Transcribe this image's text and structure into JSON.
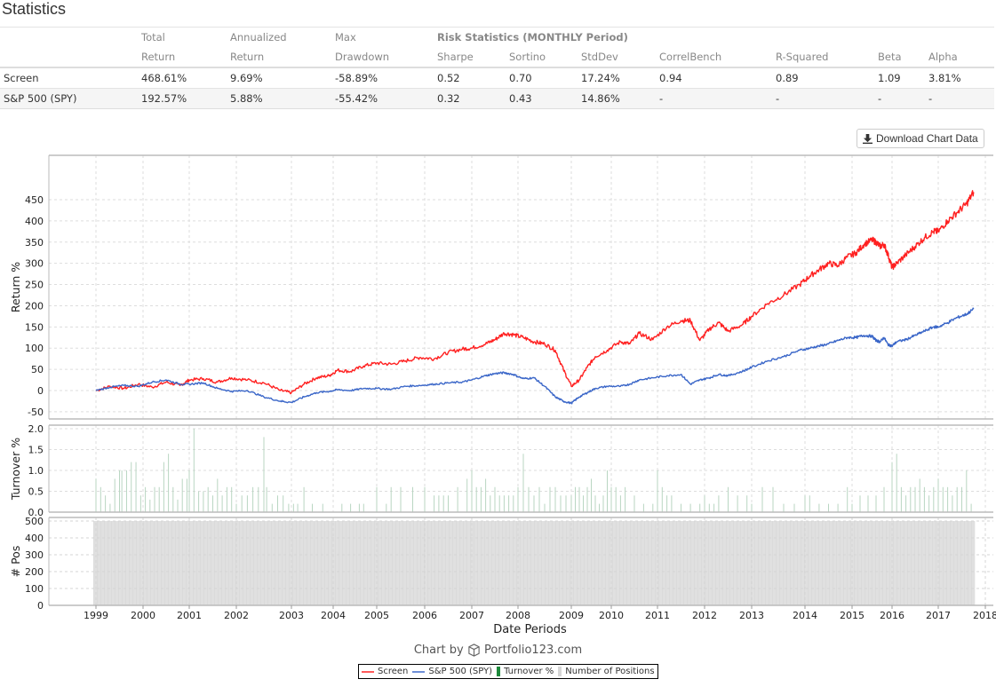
{
  "page": {
    "title": "Statistics",
    "download_button": "Download Chart Data",
    "credit_prefix": "Chart by",
    "credit_brand": "Portfolio123.com"
  },
  "stats_table": {
    "header_row1": [
      "",
      "Total",
      "Annualized",
      "Max",
      "Risk Statistics (MONTHLY Period)",
      "",
      "",
      "",
      "",
      "",
      ""
    ],
    "header_row2": [
      "",
      "Return",
      "Return",
      "Drawdown",
      "Sharpe",
      "Sortino",
      "StdDev",
      "CorrelBench",
      "R-Squared",
      "Beta",
      "Alpha"
    ],
    "rows": [
      {
        "name": "Screen",
        "values": [
          "468.61%",
          "9.69%",
          "-58.89%",
          "0.52",
          "0.70",
          "17.24%",
          "0.94",
          "0.89",
          "1.09",
          "3.81%"
        ]
      },
      {
        "name": "S&P 500 (SPY)",
        "values": [
          "192.57%",
          "5.88%",
          "-55.42%",
          "0.32",
          "0.43",
          "14.86%",
          "-",
          "-",
          "-",
          "-"
        ]
      }
    ],
    "negative_color": "#c9302c"
  },
  "chart_data": [
    {
      "type": "line",
      "title": "",
      "xlabel": "Date Periods",
      "ylabel": "Return %",
      "ylim": [
        -55,
        490
      ],
      "yticks": [
        -50,
        0,
        50,
        100,
        150,
        200,
        250,
        300,
        350,
        400,
        450
      ],
      "xlim": [
        1997.95,
        2018.2
      ],
      "xticks": [
        "1999",
        "2000",
        "2001",
        "2002",
        "2003",
        "2004",
        "2005",
        "2006",
        "2007",
        "2008",
        "2009",
        "2010",
        "2011",
        "2012",
        "2013",
        "2014",
        "2015",
        "2016",
        "2017",
        "2018"
      ],
      "grid": true,
      "series": [
        {
          "name": "Screen",
          "color": "#ff2020",
          "x": [
            1999.0,
            1999.3,
            1999.6,
            1999.9,
            2000.2,
            2000.5,
            2000.8,
            2001.0,
            2001.3,
            2001.6,
            2001.9,
            2002.2,
            2002.5,
            2002.8,
            2003.0,
            2003.3,
            2003.6,
            2003.9,
            2004.1,
            2004.4,
            2004.7,
            2005.0,
            2005.3,
            2005.6,
            2005.9,
            2006.2,
            2006.5,
            2006.8,
            2007.0,
            2007.3,
            2007.5,
            2007.7,
            2007.9,
            2008.1,
            2008.3,
            2008.5,
            2008.7,
            2008.85,
            2009.0,
            2009.2,
            2009.4,
            2009.6,
            2009.9,
            2010.2,
            2010.4,
            2010.6,
            2010.9,
            2011.2,
            2011.5,
            2011.7,
            2011.9,
            2012.1,
            2012.3,
            2012.5,
            2012.8,
            2013.0,
            2013.3,
            2013.6,
            2013.9,
            2014.1,
            2014.3,
            2014.5,
            2014.7,
            2014.9,
            2015.1,
            2015.3,
            2015.5,
            2015.6,
            2015.7,
            2015.8,
            2015.9,
            2016.0,
            2016.1,
            2016.3,
            2016.5,
            2016.7,
            2016.9,
            2017.0,
            2017.2,
            2017.4,
            2017.6,
            2017.75
          ],
          "values": [
            0,
            10,
            5,
            15,
            8,
            20,
            12,
            25,
            28,
            20,
            30,
            25,
            18,
            0,
            -5,
            15,
            30,
            35,
            48,
            45,
            58,
            65,
            62,
            70,
            78,
            75,
            90,
            98,
            100,
            110,
            120,
            135,
            132,
            125,
            115,
            110,
            95,
            50,
            10,
            25,
            55,
            80,
            95,
            115,
            110,
            135,
            120,
            150,
            165,
            165,
            118,
            145,
            160,
            140,
            155,
            175,
            205,
            225,
            250,
            270,
            285,
            300,
            295,
            315,
            325,
            345,
            355,
            350,
            340,
            345,
            320,
            290,
            300,
            320,
            340,
            360,
            375,
            375,
            400,
            420,
            440,
            468
          ]
        },
        {
          "name": "S&P 500 (SPY)",
          "color": "#3a66c8",
          "x": [
            1999.0,
            1999.3,
            1999.6,
            1999.9,
            2000.2,
            2000.5,
            2000.8,
            2001.0,
            2001.3,
            2001.6,
            2001.9,
            2002.2,
            2002.5,
            2002.8,
            2003.0,
            2003.3,
            2003.6,
            2003.9,
            2004.1,
            2004.4,
            2004.7,
            2005.0,
            2005.3,
            2005.6,
            2005.9,
            2006.2,
            2006.5,
            2006.8,
            2007.0,
            2007.3,
            2007.5,
            2007.7,
            2007.9,
            2008.1,
            2008.3,
            2008.5,
            2008.7,
            2008.85,
            2009.0,
            2009.2,
            2009.4,
            2009.6,
            2009.9,
            2010.2,
            2010.4,
            2010.6,
            2010.9,
            2011.2,
            2011.5,
            2011.7,
            2011.9,
            2012.1,
            2012.3,
            2012.5,
            2012.8,
            2013.0,
            2013.3,
            2013.6,
            2013.9,
            2014.1,
            2014.3,
            2014.5,
            2014.7,
            2014.9,
            2015.1,
            2015.3,
            2015.5,
            2015.6,
            2015.7,
            2015.8,
            2015.9,
            2016.0,
            2016.1,
            2016.3,
            2016.5,
            2016.7,
            2016.9,
            2017.0,
            2017.2,
            2017.4,
            2017.6,
            2017.75
          ],
          "values": [
            0,
            8,
            12,
            10,
            20,
            25,
            15,
            15,
            18,
            5,
            -2,
            0,
            -15,
            -25,
            -28,
            -15,
            -5,
            -2,
            2,
            0,
            5,
            5,
            3,
            10,
            12,
            15,
            18,
            20,
            25,
            35,
            40,
            42,
            38,
            28,
            30,
            10,
            -15,
            -25,
            -30,
            -15,
            -5,
            5,
            10,
            10,
            15,
            25,
            30,
            35,
            38,
            15,
            25,
            30,
            38,
            35,
            45,
            55,
            70,
            80,
            95,
            100,
            105,
            110,
            118,
            125,
            125,
            130,
            128,
            118,
            115,
            125,
            108,
            105,
            115,
            120,
            130,
            140,
            150,
            150,
            160,
            172,
            180,
            192
          ]
        }
      ]
    },
    {
      "type": "bar",
      "ylabel": "Turnover %",
      "ylim": [
        0,
        2.05
      ],
      "yticks": [
        "0.0",
        "0.5",
        "1.0",
        "1.5",
        "2.0"
      ],
      "grid": true,
      "series": [
        {
          "name": "Turnover %",
          "color": "#2e8b57",
          "x": [
            1999.0,
            1999.1,
            1999.2,
            1999.3,
            1999.4,
            1999.5,
            1999.55,
            1999.65,
            1999.75,
            1999.85,
            1999.95,
            2000.05,
            2000.15,
            2000.25,
            2000.35,
            2000.45,
            2000.55,
            2000.65,
            2000.75,
            2000.85,
            2000.95,
            2001.0,
            2001.1,
            2001.2,
            2001.3,
            2001.4,
            2001.5,
            2001.6,
            2001.7,
            2001.8,
            2001.9,
            2002.0,
            2002.1,
            2002.2,
            2002.3,
            2002.4,
            2002.5,
            2002.55,
            2002.65,
            2002.75,
            2002.85,
            2002.95,
            2003.05,
            2003.15,
            2003.3,
            2003.5,
            2003.75,
            2004.2,
            2004.4,
            2004.6,
            2004.7,
            2005.0,
            2005.2,
            2005.3,
            2005.5,
            2005.75,
            2006.0,
            2006.2,
            2006.3,
            2006.4,
            2006.5,
            2006.7,
            2006.9,
            2007.0,
            2007.1,
            2007.2,
            2007.3,
            2007.4,
            2007.5,
            2007.6,
            2007.7,
            2007.8,
            2007.9,
            2008.0,
            2008.1,
            2008.2,
            2008.3,
            2008.4,
            2008.5,
            2008.6,
            2008.7,
            2008.8,
            2008.9,
            2009.0,
            2009.1,
            2009.2,
            2009.3,
            2009.4,
            2009.5,
            2009.6,
            2009.7,
            2009.8,
            2009.9,
            2010.0,
            2010.1,
            2010.2,
            2010.3,
            2010.5,
            2010.7,
            2010.9,
            2011.0,
            2011.1,
            2011.2,
            2011.3,
            2011.5,
            2011.7,
            2011.9,
            2012.0,
            2012.1,
            2012.2,
            2012.3,
            2012.5,
            2012.7,
            2012.9,
            2013.0,
            2013.2,
            2013.4,
            2013.6,
            2013.8,
            2014.0,
            2014.1,
            2014.3,
            2014.5,
            2014.7,
            2014.9,
            2015.0,
            2015.2,
            2015.4,
            2015.6,
            2015.8,
            2016.0,
            2016.1,
            2016.2,
            2016.3,
            2016.4,
            2016.5,
            2016.6,
            2016.7,
            2016.8,
            2016.9,
            2017.0,
            2017.1,
            2017.2,
            2017.3,
            2017.4,
            2017.5,
            2017.6,
            2017.7
          ],
          "values": [
            0.8,
            0.6,
            0.4,
            0.2,
            0.8,
            1.0,
            1.0,
            1.0,
            1.2,
            1.2,
            0.4,
            0.6,
            0.3,
            0.6,
            0.6,
            1.2,
            1.4,
            0.6,
            0.3,
            0.8,
            0.8,
            1.0,
            2.0,
            0.5,
            0.5,
            0.6,
            0.4,
            0.8,
            0.4,
            0.6,
            0.6,
            0.2,
            0.4,
            0.4,
            0.6,
            0.6,
            1.8,
            0.6,
            0.2,
            0.4,
            0.4,
            0.2,
            0.2,
            0.2,
            0.6,
            0.2,
            0.2,
            0.2,
            0.2,
            0.2,
            0.2,
            0.6,
            0.2,
            0.6,
            0.6,
            0.6,
            0.6,
            0.4,
            0.4,
            0.4,
            0.4,
            0.6,
            0.8,
            1.0,
            0.6,
            0.6,
            0.8,
            0.4,
            0.6,
            0.4,
            0.4,
            0.4,
            0.4,
            0.6,
            1.4,
            0.6,
            0.4,
            0.6,
            0.2,
            0.6,
            0.6,
            0.4,
            0.4,
            0.4,
            0.6,
            0.6,
            0.4,
            0.6,
            0.8,
            0.4,
            0.2,
            0.4,
            1.0,
            0.6,
            0.6,
            0.4,
            0.6,
            0.4,
            0.2,
            0.2,
            1.0,
            0.6,
            0.4,
            0.4,
            0.2,
            0.2,
            0.2,
            0.4,
            0.2,
            0.2,
            0.4,
            0.6,
            0.4,
            0.4,
            0.2,
            0.6,
            0.6,
            0.2,
            0.2,
            0.4,
            0.4,
            0.2,
            0.2,
            0.2,
            0.6,
            0.2,
            0.4,
            0.4,
            0.4,
            0.6,
            1.2,
            1.4,
            0.6,
            0.4,
            0.6,
            0.6,
            0.8,
            0.6,
            0.4,
            0.6,
            0.8,
            0.6,
            0.6,
            0.4,
            0.6,
            0.6,
            1.0,
            0.2,
            1.2,
            0.6
          ],
          "note": "bar heights estimated; many are thin stems"
        }
      ]
    },
    {
      "type": "area",
      "ylabel": "# Pos",
      "ylim": [
        0,
        520
      ],
      "yticks": [
        0,
        100,
        200,
        300,
        400,
        500
      ],
      "grid": true,
      "series": [
        {
          "name": "Number of Positions",
          "color": "#dddddd",
          "x_start": 1998.95,
          "x_end": 2017.78,
          "value": 500
        }
      ]
    }
  ],
  "legend": {
    "items": [
      {
        "label": "Screen",
        "kind": "line",
        "color": "#ff5a5a"
      },
      {
        "label": "S&P 500 (SPY)",
        "kind": "line",
        "color": "#6e8fd8"
      },
      {
        "label": "Turnover %",
        "kind": "box",
        "color": "#1e8a3c"
      },
      {
        "label": "Number of Positions",
        "kind": "box",
        "color": "#d6d6d6"
      }
    ]
  }
}
